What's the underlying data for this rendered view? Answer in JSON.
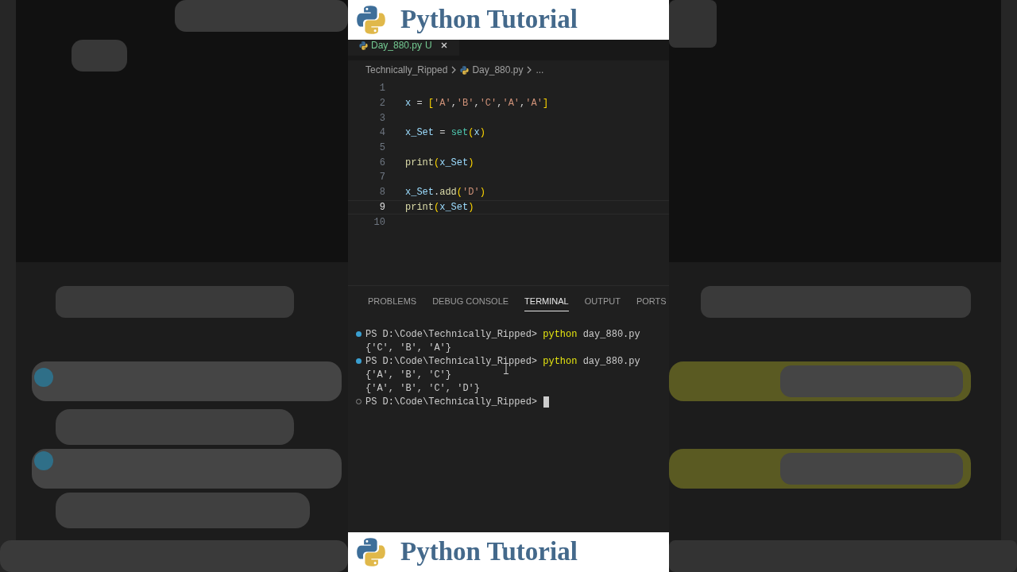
{
  "banner_top": {
    "title": "Python Tutorial"
  },
  "editor": {
    "tab": {
      "filename": "Day_880.py",
      "badge": "U",
      "selected": true
    },
    "breadcrumbs": [
      "Technically_Ripped",
      "Day_880.py",
      "..."
    ],
    "lines": [
      {
        "number": "1",
        "current": false
      },
      {
        "number": "2",
        "current": false,
        "tokens": [
          {
            "text": "x",
            "kind": "var"
          },
          {
            "text": " = ",
            "kind": "op"
          },
          {
            "text": "[",
            "kind": "bracket"
          },
          {
            "text": "'A'",
            "kind": "string"
          },
          {
            "text": ",",
            "kind": "op"
          },
          {
            "text": "'B'",
            "kind": "string"
          },
          {
            "text": ",",
            "kind": "op"
          },
          {
            "text": "'C'",
            "kind": "string"
          },
          {
            "text": ",",
            "kind": "op"
          },
          {
            "text": "'A'",
            "kind": "string"
          },
          {
            "text": ",",
            "kind": "op"
          },
          {
            "text": "'A'",
            "kind": "string"
          },
          {
            "text": "]",
            "kind": "bracket"
          }
        ]
      },
      {
        "number": "3",
        "current": false
      },
      {
        "number": "4",
        "current": false,
        "tokens": [
          {
            "text": "x_Set",
            "kind": "var"
          },
          {
            "text": " = ",
            "kind": "op"
          },
          {
            "text": "set",
            "kind": "class"
          },
          {
            "text": "(",
            "kind": "bracket"
          },
          {
            "text": "x",
            "kind": "var"
          },
          {
            "text": ")",
            "kind": "bracket"
          }
        ]
      },
      {
        "number": "5",
        "current": false
      },
      {
        "number": "6",
        "current": false,
        "tokens": [
          {
            "text": "print",
            "kind": "func"
          },
          {
            "text": "(",
            "kind": "bracket"
          },
          {
            "text": "x_Set",
            "kind": "var"
          },
          {
            "text": ")",
            "kind": "bracket"
          }
        ]
      },
      {
        "number": "7",
        "current": false
      },
      {
        "number": "8",
        "current": false,
        "tokens": [
          {
            "text": "x_Set",
            "kind": "var"
          },
          {
            "text": ".",
            "kind": "op"
          },
          {
            "text": "add",
            "kind": "func"
          },
          {
            "text": "(",
            "kind": "bracket"
          },
          {
            "text": "'D'",
            "kind": "string"
          },
          {
            "text": ")",
            "kind": "bracket"
          }
        ]
      },
      {
        "number": "9",
        "current": true,
        "tokens": [
          {
            "text": "print",
            "kind": "func"
          },
          {
            "text": "(",
            "kind": "bracket"
          },
          {
            "text": "x_Set",
            "kind": "var"
          },
          {
            "text": ")",
            "kind": "bracket"
          }
        ]
      },
      {
        "number": "10",
        "current": false
      }
    ]
  },
  "panel": {
    "tabs": [
      {
        "label": "PROBLEMS",
        "selected": false
      },
      {
        "label": "DEBUG CONSOLE",
        "selected": false
      },
      {
        "label": "TERMINAL",
        "selected": true
      },
      {
        "label": "OUTPUT",
        "selected": false
      },
      {
        "label": "PORTS",
        "selected": false
      }
    ],
    "terminal": [
      {
        "kind": "prompt",
        "succeeded": true,
        "prompt": "PS D:\\Code\\Technically_Ripped>",
        "command": "python",
        "args": "day_880.py"
      },
      {
        "kind": "output",
        "text": "{'C', 'B', 'A'}"
      },
      {
        "kind": "prompt",
        "succeeded": true,
        "prompt": "PS D:\\Code\\Technically_Ripped>",
        "command": "python",
        "args": "day_880.py"
      },
      {
        "kind": "output",
        "text": "{'A', 'B', 'C'}"
      },
      {
        "kind": "output",
        "text": "{'A', 'B', 'C', 'D'}"
      },
      {
        "kind": "prompt",
        "succeeded": false,
        "prompt": "PS D:\\Code\\Technically_Ripped>",
        "cursor": true
      }
    ]
  },
  "banner_bottom": {
    "title": "Python Tutorial"
  }
}
